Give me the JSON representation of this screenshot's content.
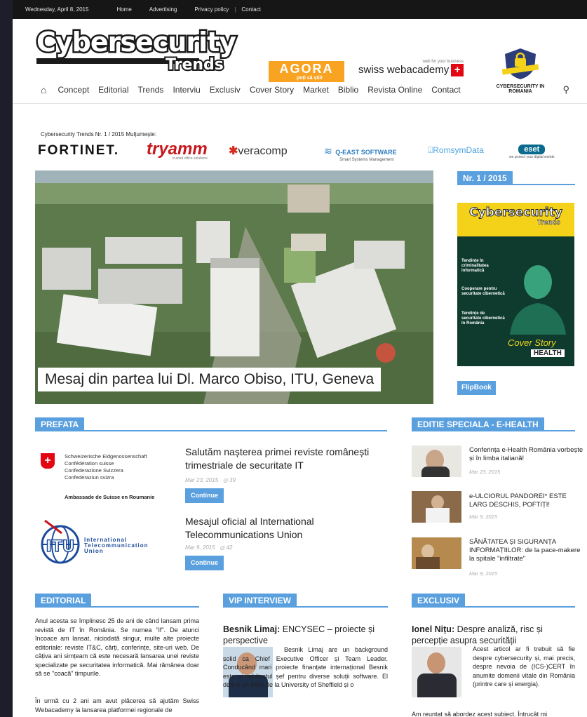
{
  "topbar": {
    "date": "Wednesday, April 8, 2015",
    "links": [
      "Home",
      "Advertising",
      "Privacy policy",
      "Contact"
    ],
    "sep": "|"
  },
  "logo": {
    "line1": "Cybersecurity",
    "line2": "Trends"
  },
  "sponsors": {
    "agora": "AGORA",
    "agora_sub": "poți să știi!",
    "swiss_small": "web for your business",
    "swiss": "swiss webacademy",
    "cir": "CYBERSECURITY IN ROMANIA"
  },
  "nav": {
    "items": [
      "Concept",
      "Editorial",
      "Trends",
      "Interviu",
      "Exclusiv",
      "Cover Story",
      "Market",
      "Biblio",
      "Revista Online",
      "Contact"
    ]
  },
  "partners": {
    "thanks": "Cybersecurity Trends Nr. 1 / 2015 Mulțumește:",
    "fortinet": "FORTINET.",
    "tryamm": "tryamm",
    "tryamm_sub": "trusted office solutions",
    "veracomp": "veracomp",
    "qeast": "Q-EAST SOFTWARE",
    "qeast_sub": "Smart Systems Management",
    "romsym": "RomsymData",
    "eset": "eset",
    "eset_sub": "we protect your digital worlds"
  },
  "slider": {
    "caption": "Mesaj din partea lui Dl. Marco Obiso, ITU, Geneva"
  },
  "issue": {
    "label": "Nr. 1 / 2015",
    "cover_title": "Cybersecurity",
    "cover_sub": "Trends",
    "cover_items": [
      "Tendințe în criminalitatea informatică",
      "Cooperare pentru securitate cibernetică",
      "Tendințe de securitate cibernetică în România"
    ],
    "cover_story": "Cover Story",
    "cover_health": "HEALTH",
    "flipbook": "FlipBook"
  },
  "prefata": {
    "label": "PREFATA",
    "swiss_lines": [
      "Schweizerische Eidgenossenschaft",
      "Confédération suisse",
      "Confederazione Svizzera",
      "Confederaziun svizra"
    ],
    "swiss_embassy": "Ambassade de Suisse en Roumanie",
    "itu_lines": [
      "International",
      "Telecommunication",
      "Union"
    ],
    "itu_logo": "ITU",
    "articles": [
      {
        "title": "Salutăm nașterea primei reviste românești trimestriale de securitate IT",
        "date": "Mar 23, 2015",
        "views": "39",
        "button": "Continue"
      },
      {
        "title": "Mesajul oficial al International Telecommunications Union",
        "date": "Mar 9, 2015",
        "views": "42",
        "button": "Continue"
      }
    ]
  },
  "special": {
    "label": "EDITIE SPECIALA - E-HEALTH",
    "items": [
      {
        "title": "Conferința e-Health România vorbește și în limba italiană!",
        "date": "Mar 23, 2015"
      },
      {
        "title": "e-ULCIORUL PANDOREI* ESTE LARG DESCHIS, POFTIȚI!",
        "date": "Mar 9, 2015"
      },
      {
        "title": "SĂNĂTATEA ȘI SIGURANȚA INFORMAȚIILOR: de la pace-makere la spitale \"infiltrate\"",
        "date": "Mar 9, 2015"
      }
    ]
  },
  "editorial": {
    "label": "EDITORIAL",
    "p1": "Anul acesta se împlinesc 25 de ani de când lansam prima revistă de IT în România. Se numea \"if\". De atunci încoace am lansat, niciodată singur, multe alte proiecte editoriale: reviste IT&C, cărți, conferințe, site-uri web. De câțiva ani simțeam că este necesară lansarea unei reviste specializate pe securitatea informatică. Mai rămânea doar să se \"coacă\" timpurile.",
    "p2": "În urmă cu 2 ani am avut plăcerea să ajutăm Swiss Webacademy la lansarea platformei regionale de"
  },
  "vip": {
    "label": "VIP INTERVIEW",
    "name": "Besnik Limaj:",
    "title": "ENCYSEC – proiecte și perspective",
    "text": "Besnik Limaj are un background solid ca Chief Executive Officer și Team Leader. Conducând mari proiecte finanțate internațional Besnik este și arhitectul șef pentru diverse soluții software. El deține un MBA de la University of Sheffield și o"
  },
  "exclusiv": {
    "label": "EXCLUSIV",
    "name": "Ionel Nițu:",
    "title": "Despre analiză, risc și percepție asupra securității",
    "text": "Acest articol ar fi trebuit să fie despre cybersecurity și, mai precis, despre nevoia de (ICS-)CERT în anumite domenii vitale din România (printre care și energia).",
    "bottom": "Am reuntat să abordez acest subiect. Întrucât mi"
  }
}
